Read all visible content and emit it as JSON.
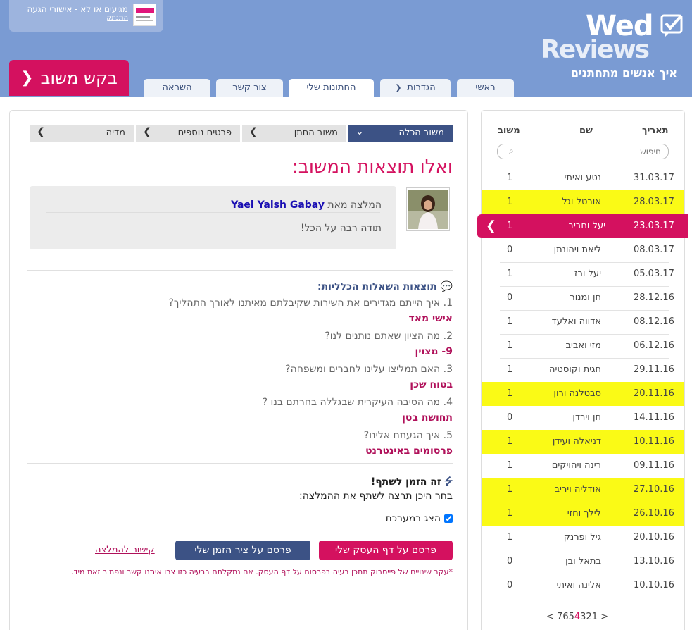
{
  "header": {
    "business_name": "מגיעים או לא - אישורי הגעה",
    "logout_label": "התנתק",
    "brand_top": "Wed",
    "brand_bottom": "Reviews",
    "tagline": "איך אנשים מתחתנים",
    "cta_label": "בקש משוב",
    "tabs": [
      {
        "label": "ראשי"
      },
      {
        "label": "הגדרות"
      },
      {
        "label": "החתונות שלי"
      },
      {
        "label": "צור קשר"
      },
      {
        "label": "השראה"
      }
    ]
  },
  "sidebar": {
    "col_date": "תאריך",
    "col_name": "שם",
    "col_score": "משוב",
    "search_placeholder": "חיפוש",
    "rows": [
      {
        "date": "31.03.17",
        "name": "נטע ואיתי",
        "score": "1"
      },
      {
        "date": "28.03.17",
        "name": "אורטל וגל",
        "score": "1"
      },
      {
        "date": "23.03.17",
        "name": "יעל וחביב",
        "score": "1"
      },
      {
        "date": "08.03.17",
        "name": "ליאת ויהונתן",
        "score": "0"
      },
      {
        "date": "05.03.17",
        "name": "יעל ורז",
        "score": "1"
      },
      {
        "date": "28.12.16",
        "name": "חן ומנור",
        "score": "0"
      },
      {
        "date": "08.12.16",
        "name": "אדווה ואלעד",
        "score": "1"
      },
      {
        "date": "06.12.16",
        "name": "מזי ואביב",
        "score": "1"
      },
      {
        "date": "29.11.16",
        "name": "חגית וקוסטיה",
        "score": "1"
      },
      {
        "date": "20.11.16",
        "name": "סבטלנה ורון",
        "score": "1"
      },
      {
        "date": "14.11.16",
        "name": "חן וירדן",
        "score": "0"
      },
      {
        "date": "10.11.16",
        "name": "דניאלה ועידן",
        "score": "1"
      },
      {
        "date": "09.11.16",
        "name": "רינה ויהויקים",
        "score": "1"
      },
      {
        "date": "27.10.16",
        "name": "אודליה ויריב",
        "score": "1"
      },
      {
        "date": "26.10.16",
        "name": "לילך וחזי",
        "score": "1"
      },
      {
        "date": "20.10.16",
        "name": "גיל ופרנק",
        "score": "1"
      },
      {
        "date": "13.10.16",
        "name": "בתאל ובן",
        "score": "0"
      },
      {
        "date": "10.10.16",
        "name": "אלינה ואיתי",
        "score": "0"
      }
    ],
    "pager": {
      "prev": "<",
      "before": "765",
      "current": "4",
      "after": "321",
      "next": ">"
    }
  },
  "main": {
    "steps": [
      {
        "label": "משוב הכלה"
      },
      {
        "label": "משוב החתן"
      },
      {
        "label": "פרטים נוספים"
      },
      {
        "label": "מדיה"
      }
    ],
    "title": "ואלו תוצאות המשוב:",
    "rec_from_prefix": "המלצה מאת",
    "rec_author": "Yael Yaish Gabay",
    "rec_text": "תודה רבה על הכל!",
    "general_title": "תוצאות השאלות הכלליות:",
    "questions": [
      {
        "q": "1. איך הייתם מגדירים את השירות שקיבלתם מאיתנו לאורך התהליך?",
        "a": "אישי מאד"
      },
      {
        "q": "2. מה הציון שאתם נותנים לנו?",
        "a": "9- מצוין"
      },
      {
        "q": "3. האם תמליצו עלינו לחברים ומשפחה?",
        "a": "בטוח שכן"
      },
      {
        "q": "4. מה הסיבה העיקרית שבגללה בחרתם בנו ?",
        "a": "תחושת בטן"
      },
      {
        "q": "5. איך הגעתם אלינו?",
        "a": "פרסומים באינטרנט"
      }
    ],
    "share_title": "זה הזמן לשתף!",
    "share_sub": "בחר היכן תרצה לשתף את ההמלצה:",
    "show_in_system": "הצג במערכת",
    "btn_business": "פרסם על דף העסק שלי",
    "btn_timeline": "פרסם על ציר הזמן שלי",
    "link_label": "קישור להמלצה",
    "footnote": "*עקב שינויים של פייסבוק תתכן בעיה בפרסום על דף העסק. אם נתקלתם בבעיה כזו צרו איתנו קשר ונפתור זאת מיד."
  },
  "colors": {
    "header_bg": "#7a9bd3",
    "accent_pink": "#d4115f",
    "accent_blue": "#3c5285",
    "highlight_yellow": "#fafa16"
  }
}
